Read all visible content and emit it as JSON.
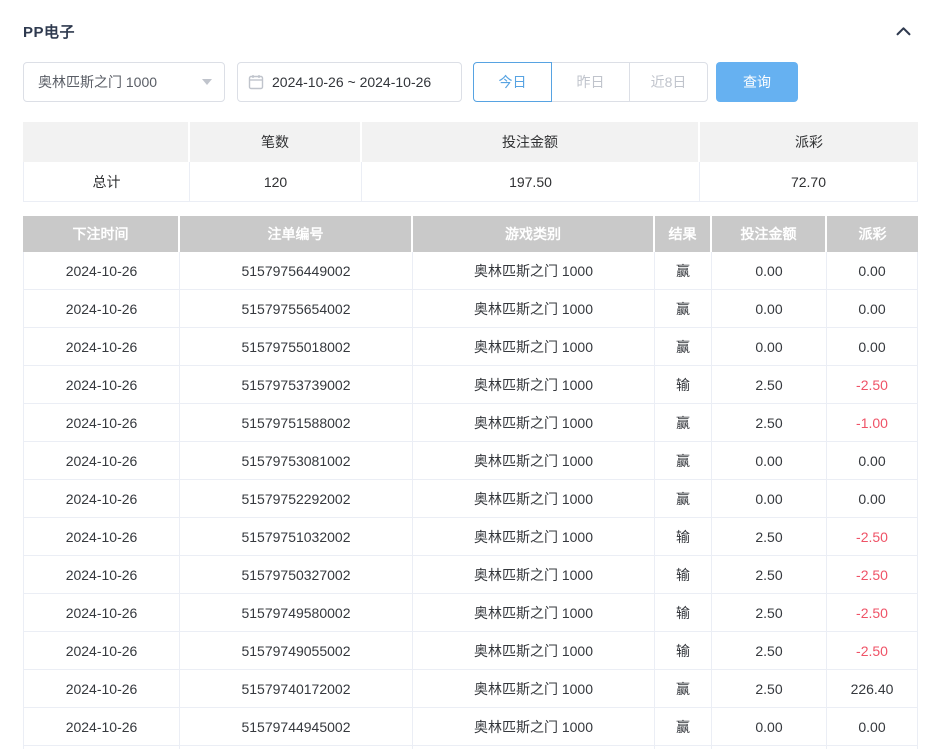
{
  "panel": {
    "title": "PP电子",
    "collapse_icon": "chevron-up"
  },
  "filters": {
    "game_select": {
      "value": "奥林匹斯之门 1000"
    },
    "date_range": {
      "value": "2024-10-26 ~ 2024-10-26"
    },
    "quick_buttons": [
      {
        "label": "今日",
        "active": true
      },
      {
        "label": "昨日",
        "active": false
      },
      {
        "label": "近8日",
        "active": false
      }
    ],
    "query_label": "查询"
  },
  "summary": {
    "headers": [
      "",
      "笔数",
      "投注金额",
      "派彩"
    ],
    "row": {
      "label": "总计",
      "count": "120",
      "bet_amount": "197.50",
      "payout": "72.70"
    }
  },
  "table": {
    "headers": [
      "下注时间",
      "注单编号",
      "游戏类别",
      "结果",
      "投注金额",
      "派彩"
    ],
    "rows": [
      [
        "2024-10-26",
        "51579756449002",
        "奥林匹斯之门 1000",
        "赢",
        "0.00",
        "0.00"
      ],
      [
        "2024-10-26",
        "51579755654002",
        "奥林匹斯之门 1000",
        "赢",
        "0.00",
        "0.00"
      ],
      [
        "2024-10-26",
        "51579755018002",
        "奥林匹斯之门 1000",
        "赢",
        "0.00",
        "0.00"
      ],
      [
        "2024-10-26",
        "51579753739002",
        "奥林匹斯之门 1000",
        "输",
        "2.50",
        "-2.50"
      ],
      [
        "2024-10-26",
        "51579751588002",
        "奥林匹斯之门 1000",
        "赢",
        "2.50",
        "-1.00"
      ],
      [
        "2024-10-26",
        "51579753081002",
        "奥林匹斯之门 1000",
        "赢",
        "0.00",
        "0.00"
      ],
      [
        "2024-10-26",
        "51579752292002",
        "奥林匹斯之门 1000",
        "赢",
        "0.00",
        "0.00"
      ],
      [
        "2024-10-26",
        "51579751032002",
        "奥林匹斯之门 1000",
        "输",
        "2.50",
        "-2.50"
      ],
      [
        "2024-10-26",
        "51579750327002",
        "奥林匹斯之门 1000",
        "输",
        "2.50",
        "-2.50"
      ],
      [
        "2024-10-26",
        "51579749580002",
        "奥林匹斯之门 1000",
        "输",
        "2.50",
        "-2.50"
      ],
      [
        "2024-10-26",
        "51579749055002",
        "奥林匹斯之门 1000",
        "输",
        "2.50",
        "-2.50"
      ],
      [
        "2024-10-26",
        "51579740172002",
        "奥林匹斯之门 1000",
        "赢",
        "2.50",
        "226.40"
      ],
      [
        "2024-10-26",
        "51579744945002",
        "奥林匹斯之门 1000",
        "赢",
        "0.00",
        "0.00"
      ]
    ]
  },
  "colors": {
    "accent_blue": "#57a3e2",
    "query_button_blue": "#66b1f1",
    "danger_red": "#ef5367",
    "table_header_gray": "#c9c9c9",
    "summary_header_gray": "#f2f2f2",
    "title_dark": "#2f3a4f"
  }
}
